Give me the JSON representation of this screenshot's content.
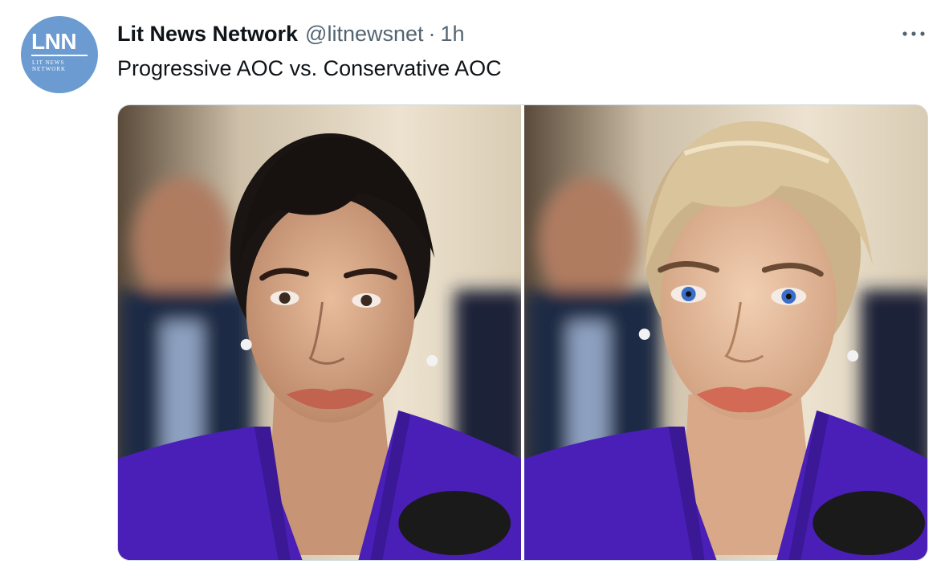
{
  "tweet": {
    "avatar": {
      "logo_text": "LNN",
      "sub_text": "LIT NEWS NETWORK",
      "bg_color": "#6b9bd1"
    },
    "author": {
      "display_name": "Lit News Network",
      "handle": "@litnewsnet",
      "separator": "·",
      "time": "1h"
    },
    "more_icon": "more-horizontal-icon",
    "text": "Progressive AOC vs. Conservative AOC",
    "media": {
      "count": 2,
      "photos": [
        {
          "subject": "dark-haired woman in purple jacket"
        },
        {
          "subject": "blonde woman in purple jacket"
        }
      ]
    }
  },
  "colors": {
    "text_primary": "#0f1419",
    "text_secondary": "#536471",
    "border": "#cfd9de",
    "jacket_purple": "#4a1fb8"
  }
}
